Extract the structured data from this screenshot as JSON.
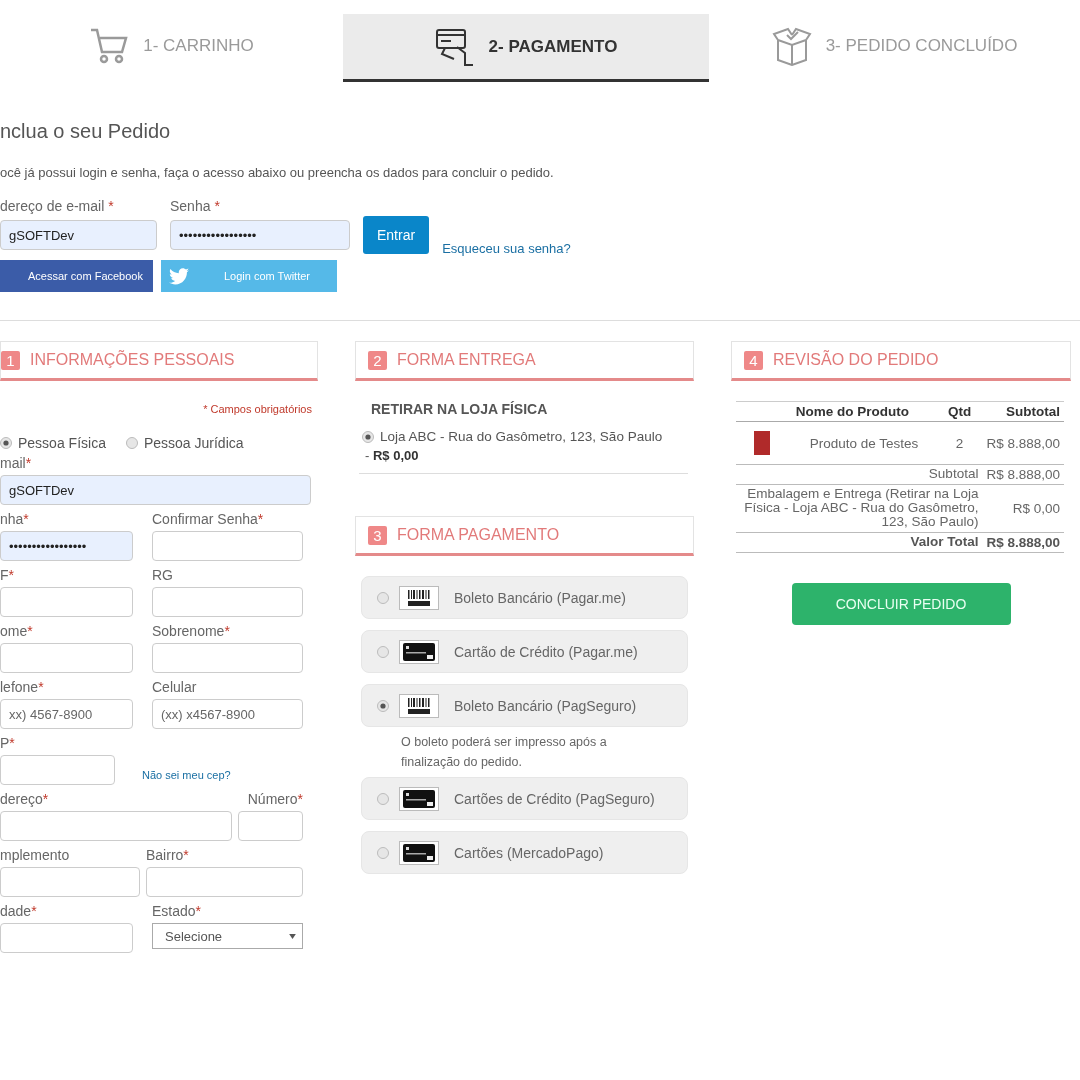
{
  "steps": [
    {
      "label": "1- CARRINHO",
      "selected": false
    },
    {
      "label": "2- PAGAMENTO",
      "selected": true
    },
    {
      "label": "3- PEDIDO CONCLUÍDO",
      "selected": false
    }
  ],
  "login": {
    "title": "nclua o seu Pedido",
    "intro": "ocê já possui login e senha, faça o acesso abaixo ou preencha os dados para concluir o pedido.",
    "email": {
      "label": "dereço de e-mail",
      "mark": "*",
      "value": "gSOFTDev"
    },
    "password": {
      "label": "Senha",
      "mark": "*",
      "value": "•••••••••••••••••"
    },
    "submit": "Entrar",
    "forgot_link": "Esqueceu sua senha?",
    "facebook_button": "Acessar com Facebook",
    "twitter_button": "Login com Twitter"
  },
  "personal": {
    "number": "1",
    "title": "INFORMAÇÕES PESSOAIS",
    "required_note": "* Campos obrigatórios",
    "person_types": [
      {
        "label": "Pessoa Física",
        "selected": true
      },
      {
        "label": "Pessoa Jurídica",
        "selected": false
      }
    ],
    "rows": [
      [
        {
          "kind": "input",
          "label": "mail",
          "mark": "*",
          "value": "gSOFTDev",
          "autofilled": true
        }
      ],
      [
        {
          "kind": "input",
          "label": "nha",
          "mark": "*",
          "value": "•••••••••••••••••",
          "autofilled": true
        },
        {
          "kind": "input",
          "label": "Confirmar Senha",
          "mark": "*",
          "autofilled": false
        }
      ],
      [
        {
          "kind": "input",
          "label": "F",
          "mark": "*",
          "autofilled": false
        },
        {
          "kind": "input",
          "label": "RG",
          "autofilled": false
        }
      ],
      [
        {
          "kind": "input",
          "label": "ome",
          "mark": "*",
          "autofilled": false
        },
        {
          "kind": "input",
          "label": "Sobrenome",
          "mark": "*",
          "autofilled": false
        }
      ],
      [
        {
          "kind": "input",
          "label": "lefone",
          "mark": "*",
          "placeholder": "xx) 4567-8900",
          "autofilled": false
        },
        {
          "kind": "input",
          "label": "Celular",
          "placeholder": "(xx) x4567-8900",
          "autofilled": false
        }
      ],
      [
        {
          "kind": "input",
          "label": "P",
          "mark": "*",
          "autofilled": false
        },
        {
          "kind": "link",
          "label": "Não sei meu cep?"
        }
      ],
      [
        {
          "kind": "input",
          "label": "dereço",
          "mark": "*",
          "autofilled": false
        },
        {
          "kind": "input",
          "label": "Número",
          "mark": "*",
          "autofilled": false
        }
      ],
      [
        {
          "kind": "input",
          "label": "mplemento",
          "autofilled": false
        },
        {
          "kind": "input",
          "label": "Bairro",
          "mark": "*",
          "autofilled": false
        }
      ],
      [
        {
          "kind": "input",
          "label": "dade",
          "mark": "*",
          "autofilled": false
        },
        {
          "kind": "select",
          "label": "Estado",
          "mark": "*",
          "value": "Selecione"
        }
      ]
    ]
  },
  "delivery": {
    "number": "2",
    "title": "FORMA ENTREGA",
    "method": "RETIRAR NA LOJA FÍSICA",
    "option": {
      "label": "Loja ABC - Rua do Gasômetro, 123, São Paulo",
      "price": "- **R$ 0,00**",
      "selected": true
    }
  },
  "payment": {
    "number": "3",
    "title": "FORMA PAGAMENTO",
    "options": [
      {
        "label": "Boleto Bancário (Pagar.me)",
        "kind": "boleto",
        "selected": false
      },
      {
        "label": "Cartão de Crédito (Pagar.me)",
        "kind": "card",
        "selected": false
      },
      {
        "label": "Boleto Bancário (PagSeguro)",
        "kind": "boleto",
        "selected": true,
        "note": "O boleto poderá ser impresso após a finalização do pedido."
      },
      {
        "label": "Cartões de Crédito (PagSeguro)",
        "kind": "card",
        "selected": false
      },
      {
        "label": "Cartões (MercadoPago)",
        "kind": "card",
        "selected": false
      }
    ]
  },
  "review": {
    "number": "4",
    "title": "REVISÃO DO PEDIDO",
    "columns": [
      "Nome do Produto",
      "Qtd",
      "Subtotal"
    ],
    "rows": [
      {
        "product": "Produto de Testes",
        "qty": "2",
        "subtotal": "R$ 8.888,00"
      }
    ],
    "summary": [
      {
        "label": "Subtotal",
        "value": "R$ 8.888,00",
        "bold": false
      },
      {
        "label": "Embalagem e Entrega (Retirar na Loja Física - Loja ABC - Rua do Gasômetro, 123, São Paulo)",
        "value": "R$ 0,00",
        "bold": false
      },
      {
        "label": "Valor Total",
        "value": "R$ 8.888,00",
        "bold": true
      }
    ],
    "button": "CONCLUIR PEDIDO"
  }
}
